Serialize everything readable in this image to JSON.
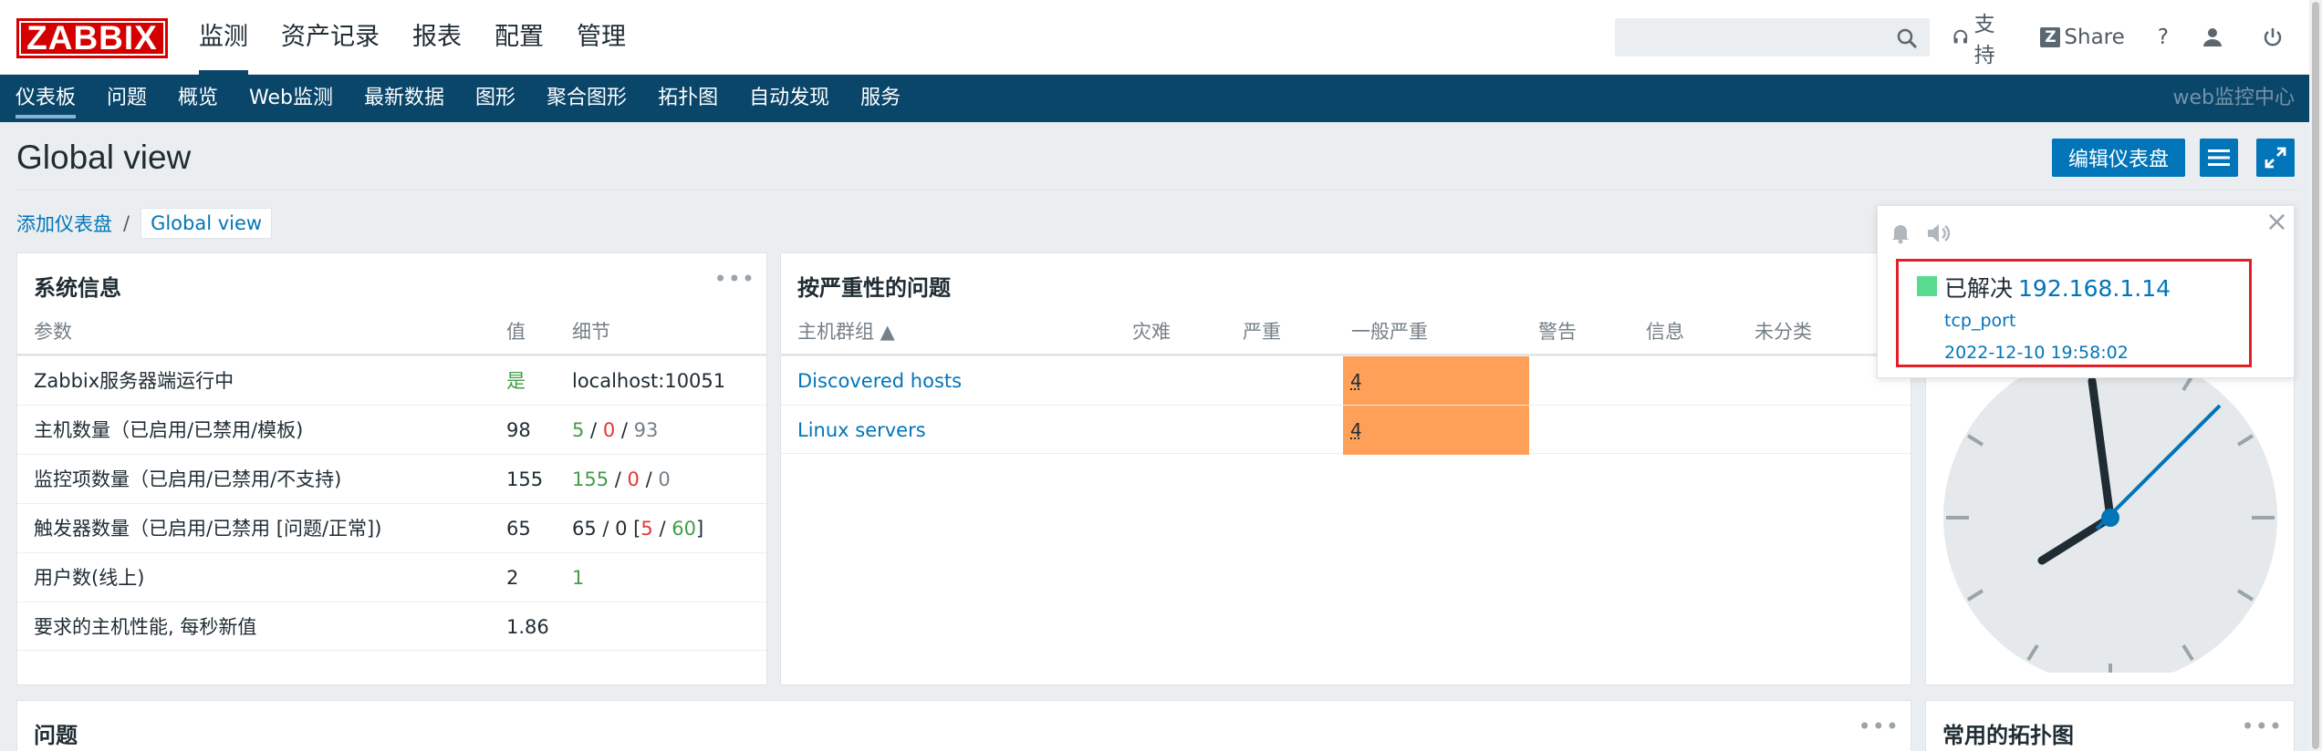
{
  "logo": "ZABBIX",
  "main_nav": [
    "监测",
    "资产记录",
    "报表",
    "配置",
    "管理"
  ],
  "search": {
    "placeholder": ""
  },
  "top_right": {
    "support": "支持",
    "share": "Share",
    "help": "?"
  },
  "sub_nav": [
    "仪表板",
    "问题",
    "概览",
    "Web监测",
    "最新数据",
    "图形",
    "聚合图形",
    "拓扑图",
    "自动发现",
    "服务"
  ],
  "server_name": "web监控中心",
  "page_title": "Global view",
  "edit_dashboard": "编辑仪表盘",
  "breadcrumb": {
    "parent": "添加仪表盘",
    "sep": "/",
    "current": "Global view"
  },
  "system_info": {
    "title": "系统信息",
    "menu": "•••",
    "headers": {
      "param": "参数",
      "value": "值",
      "detail": "细节"
    },
    "rows": [
      {
        "param": "Zabbix服务器端运行中",
        "value": "是",
        "detail": "localhost:10051"
      },
      {
        "param": "主机数量（已启用/已禁用/模板)",
        "value": "98",
        "d1": "5",
        "d2": "0",
        "d3": "93",
        "s": " / "
      },
      {
        "param": "监控项数量（已启用/已禁用/不支持)",
        "value": "155",
        "d1": "155",
        "d2": "0",
        "d3": "0",
        "s": " / "
      },
      {
        "param": "触发器数量（已启用/已禁用 [问题/正常])",
        "value": "65",
        "pre": "65 / 0 [",
        "d2": "5",
        "d3": "60",
        "post": "]",
        "s": " / "
      },
      {
        "param": "用户数(线上)",
        "value": "2",
        "detail": "1"
      },
      {
        "param": "要求的主机性能, 每秒新值",
        "value": "1.86"
      }
    ]
  },
  "problems_by_severity": {
    "title": "按严重性的问题",
    "headers": [
      "主机群组 ▲",
      "灾难",
      "严重",
      "一般严重",
      "警告",
      "信息",
      "未分类"
    ],
    "rows": [
      {
        "group": "Discovered hosts",
        "average": "4"
      },
      {
        "group": "Linux servers",
        "average": "4"
      }
    ]
  },
  "problems_widget": {
    "title": "问题",
    "menu": "•••"
  },
  "maps_widget": {
    "title": "常用的拓扑图",
    "menu": "•••"
  },
  "notification": {
    "close": "×",
    "status": "已解决",
    "host": "192.168.1.14",
    "trigger": "tcp_port",
    "time": "2022-12-10 19:58:02"
  },
  "colors": {
    "brand_red": "#d40000",
    "nav_blue": "#0a466a",
    "link_blue": "#0275b8",
    "average_severity": "#ffa059",
    "resolved_green": "#59db8f"
  }
}
